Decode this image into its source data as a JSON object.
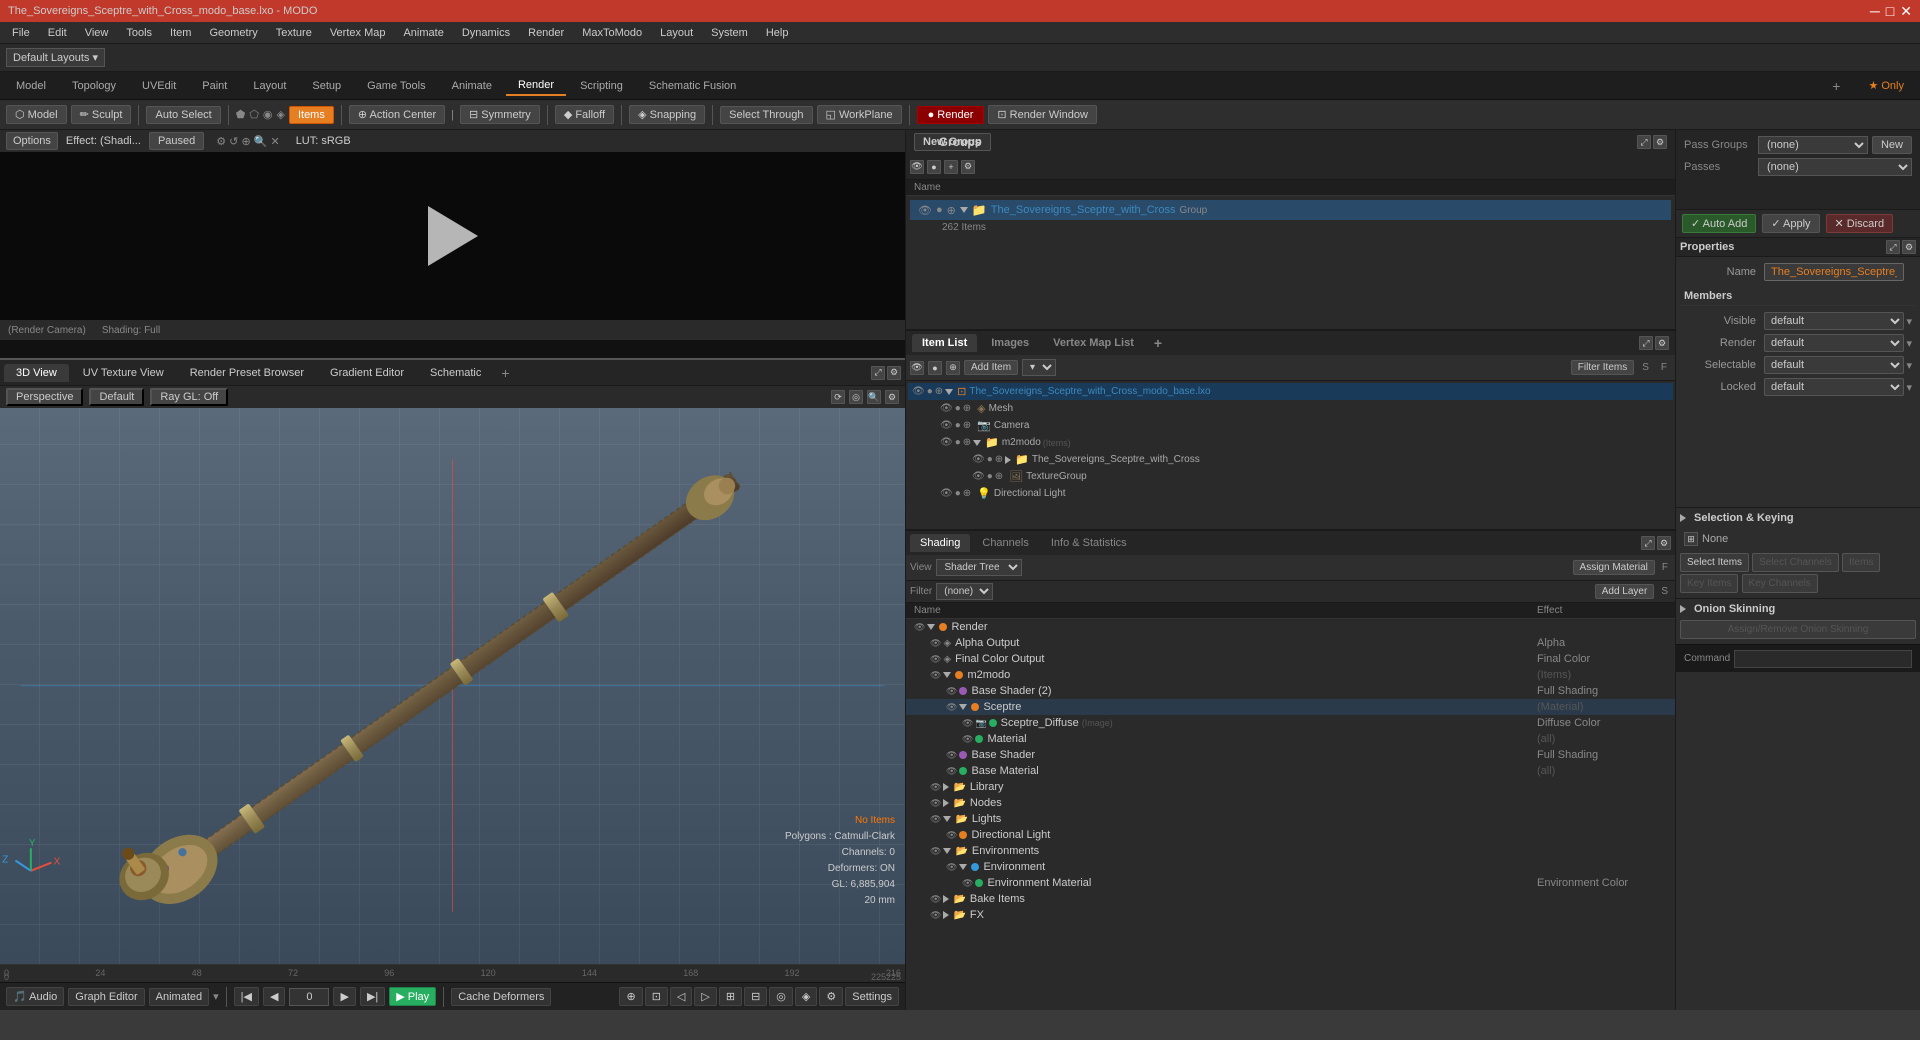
{
  "titlebar": {
    "title": "The_Sovereigns_Sceptre_with_Cross_modo_base.lxo - MODO",
    "min": "─",
    "max": "□",
    "close": "✕"
  },
  "menubar": {
    "items": [
      "File",
      "Edit",
      "View",
      "Tools",
      "Item",
      "Geometry",
      "Texture",
      "Vertex Map",
      "Animate",
      "Dynamics",
      "Render",
      "MaxToModo",
      "Layout",
      "System",
      "Help"
    ]
  },
  "layoutbar": {
    "default_layouts": "Default Layouts ▾"
  },
  "top_tabs": {
    "items": [
      "Model",
      "Topology",
      "UVEdit",
      "Paint",
      "Layout",
      "Setup",
      "Game Tools",
      "Animate",
      "Render",
      "Scripting",
      "Schematic Fusion",
      "+"
    ],
    "active": "Render"
  },
  "toolbar": {
    "model_btn": "Model",
    "sculpt_btn": "✏ Sculpt",
    "auto_select_btn": "Auto Select",
    "items_btn": "Items",
    "action_center_btn": "⊕ Action Center",
    "symmetry_btn": "⊟ Symmetry",
    "falloff_btn": "⬦ Falloff",
    "snapping_btn": "◈ Snapping",
    "select_through_btn": "Select Through",
    "workplane_btn": "◱ WorkPlane",
    "render_btn": "● Render",
    "render_window_btn": "⊡ Render Window",
    "only_btn": "★ Only"
  },
  "preview": {
    "options": "Options",
    "effect": "Effect: (Shadi...",
    "paused": "Paused",
    "lut": "LUT: sRGB",
    "render_camera": "(Render Camera)",
    "shading": "Shading: Full"
  },
  "view3d_tabs": {
    "items": [
      "3D View",
      "UV Texture View",
      "Render Preset Browser",
      "Gradient Editor",
      "Schematic",
      "+"
    ],
    "active": "3D View"
  },
  "viewport": {
    "perspective": "Perspective",
    "default": "Default",
    "ray_gl": "Ray GL: Off",
    "no_items": "No Items",
    "polygons": "Polygons : Catmull-Clark",
    "channels": "Channels: 0",
    "deformers": "Deformers: ON",
    "gl": "GL: 6,885,904",
    "distance": "20 mm"
  },
  "timeline": {
    "ticks": [
      "0",
      "24",
      "48",
      "72",
      "96",
      "120",
      "144",
      "168",
      "192",
      "216"
    ],
    "range_start": "0",
    "range_end": "225"
  },
  "groups_panel": {
    "title": "Groups",
    "new_btn": "New Group",
    "name_col": "Name",
    "item": {
      "name": "The_Sovereigns_Sceptre_with_Cross",
      "tag": "Group",
      "count": "262 Items"
    }
  },
  "items_panel": {
    "title": "Item List",
    "images_tab": "Images",
    "vertex_map_tab": "Vertex Map List",
    "add_item_btn": "Add Item",
    "filter_items_btn": "Filter Items",
    "items": [
      {
        "name": "The_Sovereigns_Sceptre_with_Cross_modo_base.lxo",
        "type": "scene",
        "indent": 0,
        "selected": true,
        "visible": true
      },
      {
        "name": "Mesh",
        "type": "mesh",
        "indent": 1,
        "selected": false,
        "visible": true
      },
      {
        "name": "Camera",
        "type": "camera",
        "indent": 1,
        "selected": false,
        "visible": true
      },
      {
        "name": "m2modo",
        "type": "group",
        "indent": 1,
        "selected": false,
        "visible": true,
        "expanded": true
      },
      {
        "name": "The_Sovereigns_Sceptre_with_Cross",
        "type": "group",
        "indent": 2,
        "selected": false,
        "visible": true
      },
      {
        "name": "TextureGroup",
        "type": "texture",
        "indent": 2,
        "selected": false,
        "visible": true
      },
      {
        "name": "Directional Light",
        "type": "light",
        "indent": 1,
        "selected": false,
        "visible": true
      }
    ]
  },
  "shader_panel": {
    "shading_tab": "Shading",
    "channels_tab": "Channels",
    "info_tab": "Info & Statistics",
    "view_label": "View",
    "view_value": "Shader Tree",
    "assign_btn": "Assign Material",
    "filter_label": "Filter",
    "filter_value": "(none)",
    "add_layer_btn": "Add Layer",
    "name_col": "Name",
    "effect_col": "Effect",
    "items": [
      {
        "name": "Render",
        "effect": "",
        "indent": 0,
        "type": "render",
        "icon": "orange"
      },
      {
        "name": "Alpha Output",
        "effect": "Alpha",
        "indent": 1,
        "type": "output"
      },
      {
        "name": "Final Color Output",
        "effect": "Final Color",
        "indent": 1,
        "type": "output"
      },
      {
        "name": "m2modo",
        "effect": "(Items)",
        "indent": 1,
        "type": "group",
        "expanded": true,
        "icon": "orange"
      },
      {
        "name": "Base Shader (2)",
        "effect": "Full Shading",
        "indent": 2,
        "type": "shader",
        "icon": "purple"
      },
      {
        "name": "Sceptre",
        "effect": "(Material)",
        "indent": 2,
        "type": "material",
        "selected": true,
        "icon": "orange"
      },
      {
        "name": "Sceptre_Diffuse",
        "effect": "Diffuse Color",
        "indent": 3,
        "type": "image",
        "subtext": "(Image)",
        "icon": "green"
      },
      {
        "name": "Material",
        "effect": "(all)",
        "indent": 3,
        "type": "material",
        "icon": "green"
      },
      {
        "name": "Base Shader",
        "effect": "Full Shading",
        "indent": 2,
        "type": "shader",
        "icon": "purple"
      },
      {
        "name": "Base Material",
        "effect": "(all)",
        "indent": 2,
        "type": "material",
        "icon": "green"
      },
      {
        "name": "Library",
        "effect": "",
        "indent": 1,
        "type": "folder"
      },
      {
        "name": "Nodes",
        "effect": "",
        "indent": 1,
        "type": "folder"
      },
      {
        "name": "Lights",
        "effect": "",
        "indent": 1,
        "type": "folder",
        "expanded": false
      },
      {
        "name": "Directional Light",
        "effect": "",
        "indent": 2,
        "type": "light",
        "icon": "orange"
      },
      {
        "name": "Environments",
        "effect": "",
        "indent": 1,
        "type": "folder",
        "expanded": false
      },
      {
        "name": "Environment",
        "effect": "",
        "indent": 2,
        "type": "env",
        "icon": "blue"
      },
      {
        "name": "Environment Material",
        "effect": "Environment Color",
        "indent": 3,
        "type": "material",
        "icon": "green"
      },
      {
        "name": "Bake Items",
        "effect": "",
        "indent": 1,
        "type": "folder"
      },
      {
        "name": "FX",
        "effect": "",
        "indent": 1,
        "type": "folder"
      }
    ]
  },
  "properties_panel": {
    "title": "Properties",
    "name_label": "Name",
    "name_value": "The_Sovereigns_Sceptre_with_Cro",
    "members_label": "Members",
    "visible_label": "Visible",
    "visible_value": "default",
    "render_label": "Render",
    "render_value": "default",
    "selectable_label": "Selectable",
    "selectable_value": "default",
    "locked_label": "Locked",
    "locked_value": "default"
  },
  "pass_groups": {
    "pass_groups_label": "Pass Groups",
    "pass_groups_value": "(none)",
    "passes_label": "Passes",
    "passes_value": "(none)",
    "new_btn": "New"
  },
  "action_buttons": {
    "auto_add": "✓ Auto Add",
    "apply": "✓ Apply",
    "discard": "✕ Discard"
  },
  "selection_keying": {
    "title": "Selection & Keying",
    "none_label": "None",
    "select_items_btn": "Select Items",
    "select_channels_btn": "Select Channels",
    "items_btn": "Items",
    "key_items_btn": "Key Items",
    "key_channels_btn": "Key Channels"
  },
  "onion_skinning": {
    "title": "Onion Skinning",
    "assign_remove_btn": "Assign/Remove Onion Skinning"
  },
  "transport": {
    "audio_btn": "🎵 Audio",
    "graph_editor_btn": "Graph Editor",
    "animated_btn": "Animated",
    "frame_value": "0",
    "play_btn": "▶ Play",
    "cache_btn": "Cache Deformers",
    "settings_btn": "Settings"
  },
  "bottom_status": {
    "items": [
      {
        "label": "No Items",
        "color": "orange"
      },
      {
        "label": "Polygons : Catmull-Clark"
      },
      {
        "label": "Channels: 0"
      },
      {
        "label": "Deformers: ON"
      },
      {
        "label": "GL: 6,885,904"
      },
      {
        "label": "20 mm"
      }
    ]
  }
}
